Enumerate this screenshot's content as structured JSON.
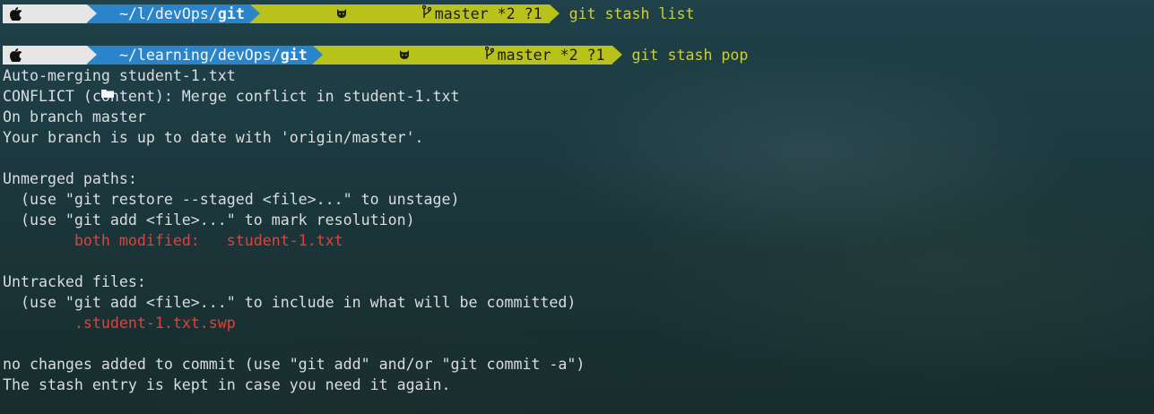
{
  "prompts": [
    {
      "path_prefix": "~/",
      "path_middle": "l/devOps/",
      "path_last": "git",
      "branch_text": "master *2 ?1",
      "command": "git stash list"
    },
    {
      "path_prefix": "~/",
      "path_middle": "learning/devOps/",
      "path_last": "git",
      "branch_text": "master *2 ?1",
      "command": "git stash pop"
    }
  ],
  "output": [
    "Auto-merging student-1.txt",
    "CONFLICT (content): Merge conflict in student-1.txt",
    "On branch master",
    "Your branch is up to date with 'origin/master'.",
    "",
    "Unmerged paths:",
    "  (use \"git restore --staged <file>...\" to unstage)",
    "  (use \"git add <file>...\" to mark resolution)",
    "",
    "",
    "Untracked files:",
    "  (use \"git add <file>...\" to include in what will be committed)",
    "",
    "",
    "no changes added to commit (use \"git add\" and/or \"git commit -a\")",
    "The stash entry is kept in case you need it again."
  ],
  "conflict": {
    "status": "both modified:",
    "file": "student-1.txt"
  },
  "untracked": {
    "file": ".student-1.txt.swp"
  },
  "colors": {
    "apple_segment": "#e6e6e6",
    "path_segment": "#2a84c9",
    "git_segment": "#b9c21a",
    "command": "#c8cf3a",
    "error_red": "#e0423a",
    "text": "#d9dde0"
  },
  "icons": {
    "os": "apple-icon",
    "dir": "folder-icon",
    "vcs": "github-cat-icon",
    "branch": "git-branch-icon"
  }
}
